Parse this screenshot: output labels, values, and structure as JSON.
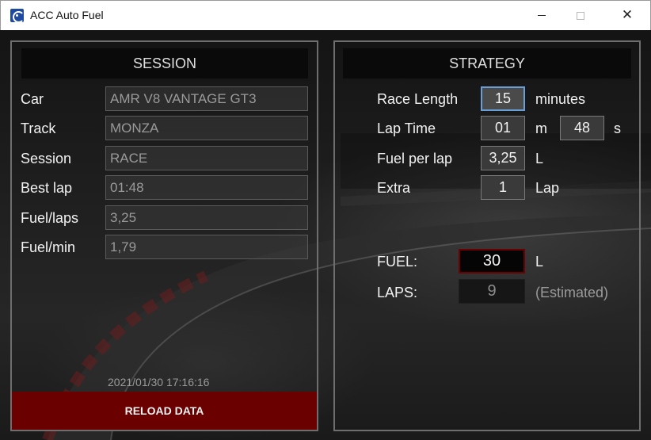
{
  "window": {
    "title": "ACC Auto Fuel",
    "controls": {
      "minimize": "minimize",
      "maximize": "maximize",
      "close": "✕"
    }
  },
  "session": {
    "header": "SESSION",
    "fields": [
      {
        "label": "Car",
        "value": "AMR V8 VANTAGE GT3"
      },
      {
        "label": "Track",
        "value": "MONZA"
      },
      {
        "label": "Session",
        "value": "RACE"
      },
      {
        "label": "Best lap",
        "value": "01:48"
      },
      {
        "label": "Fuel/laps",
        "value": "3,25"
      },
      {
        "label": "Fuel/min",
        "value": "1,79"
      }
    ],
    "timestamp": "2021/01/30 17:16:16",
    "reload_label": "RELOAD DATA"
  },
  "strategy": {
    "header": "STRATEGY",
    "race_length": {
      "label": "Race Length",
      "value": "15",
      "unit": "minutes"
    },
    "lap_time": {
      "label": "Lap Time",
      "minutes": "01",
      "minutes_unit": "m",
      "seconds": "48",
      "seconds_unit": "s"
    },
    "fuel_per_lap": {
      "label": "Fuel per lap",
      "value": "3,25",
      "unit": "L"
    },
    "extra": {
      "label": "Extra",
      "value": "1",
      "unit": "Lap"
    },
    "fuel_result": {
      "label": "FUEL:",
      "value": "30",
      "unit": "L"
    },
    "laps_result": {
      "label": "LAPS:",
      "value": "9",
      "note": "(Estimated)"
    }
  },
  "colors": {
    "reload_button": "#6a0000",
    "fuel_border": "#6a0000",
    "focus_border": "#6a9ed6"
  },
  "icons": {
    "app": "acc-logo-icon"
  }
}
